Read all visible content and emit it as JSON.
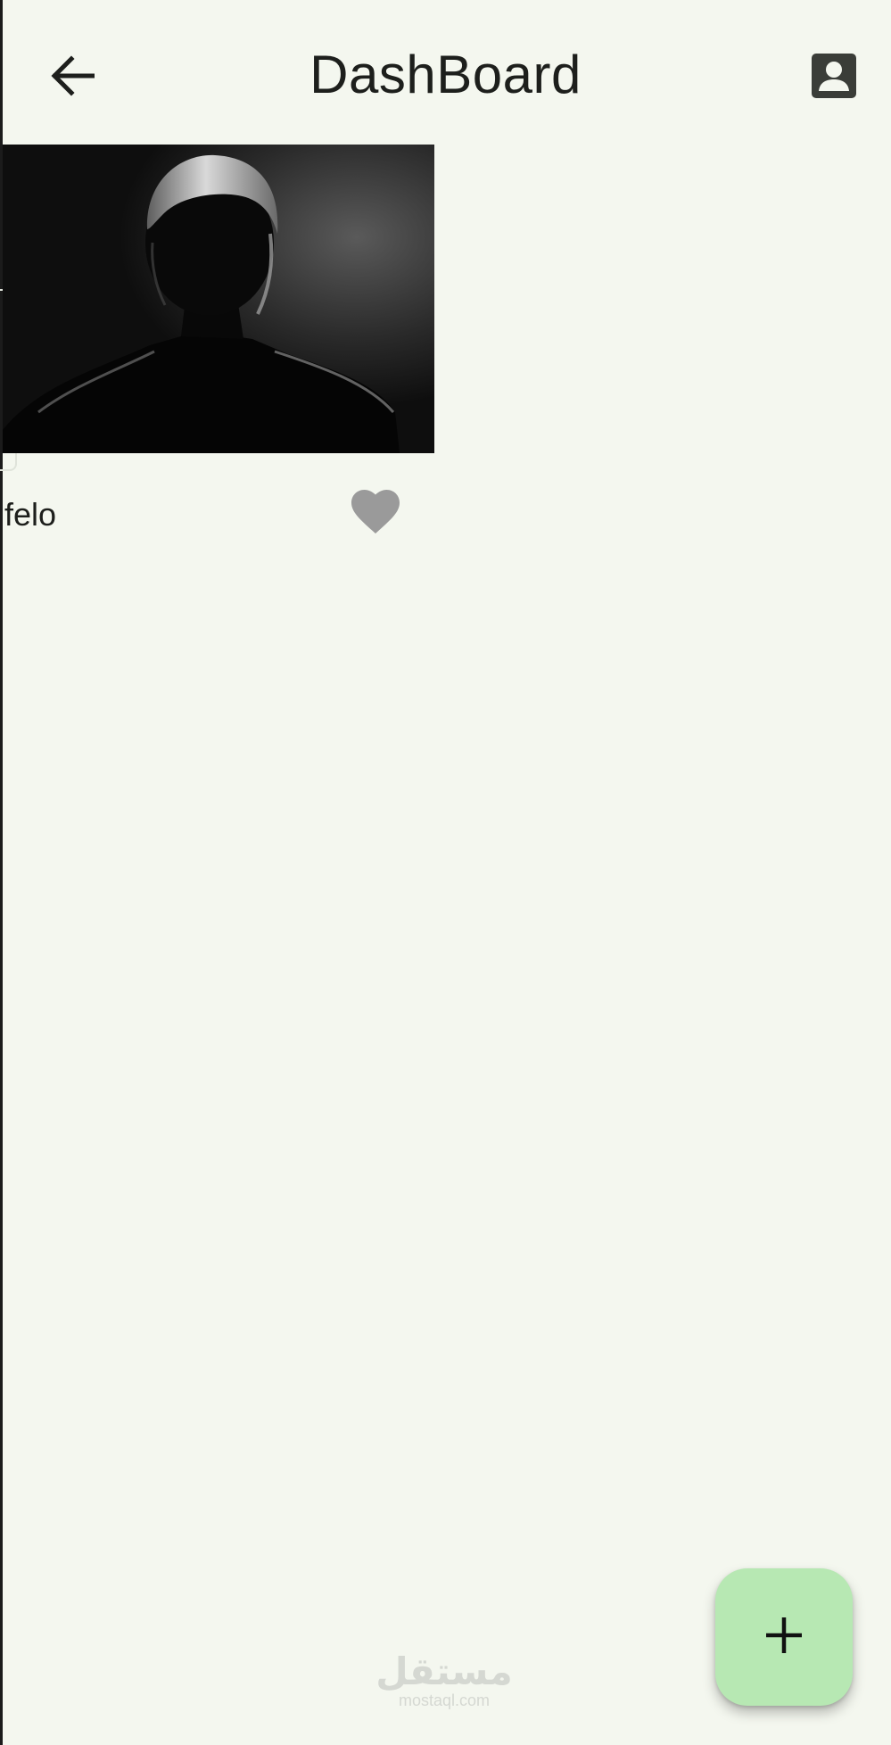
{
  "app_bar": {
    "title": "DashBoard",
    "back_icon": "arrow-back-icon",
    "profile_icon": "account-box-icon"
  },
  "items": [
    {
      "label": "felo",
      "image": "silhouette-portrait",
      "favorite_icon": "heart-icon"
    }
  ],
  "fab": {
    "icon": "plus-icon",
    "color": "#b7e8b3"
  },
  "watermark": {
    "logo": "مستقل",
    "url": "mostaql.com"
  },
  "colors": {
    "background": "#f4f7ef",
    "heart": "#9a9a9a",
    "text": "#1d1f1c"
  }
}
